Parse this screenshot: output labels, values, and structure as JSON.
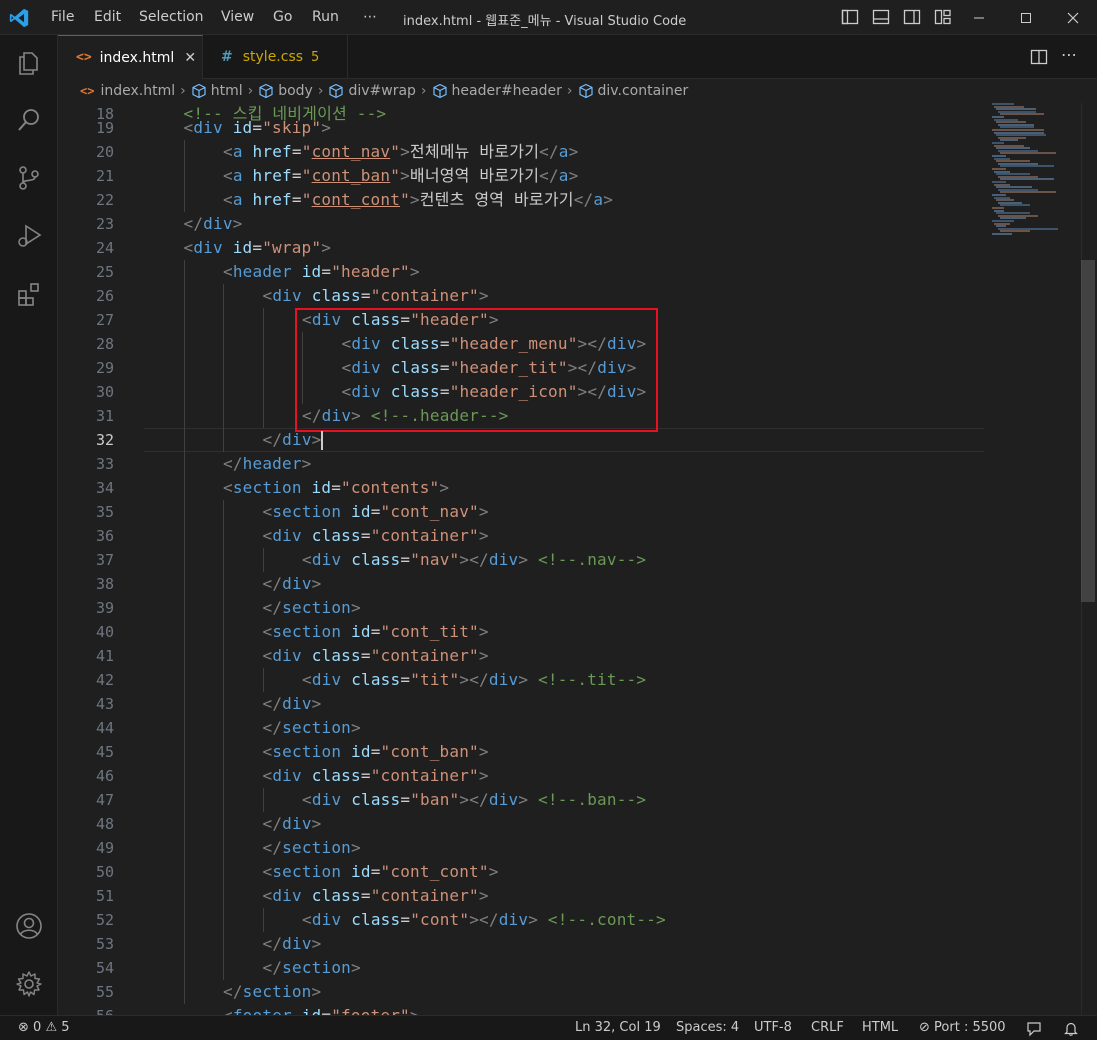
{
  "menu": [
    "File",
    "Edit",
    "Selection",
    "View",
    "Go",
    "Run",
    "⋯"
  ],
  "window_title": "index.html - 웹표준_메뉴 - Visual Studio Code",
  "tabs": [
    {
      "label": "index.html",
      "icon": "html-file-icon",
      "active": true,
      "close": "✕"
    },
    {
      "label": "style.css",
      "icon": "css-file-icon",
      "badge": "5",
      "active": false
    }
  ],
  "breadcrumb": [
    "index.html",
    "html",
    "body",
    "div#wrap",
    "header#header",
    "div.container"
  ],
  "editor": {
    "first_partial_line": {
      "number": "18",
      "text": "<!-- 스킵 네비게이션 -->"
    },
    "current_line": 32,
    "lines": [
      {
        "n": "19",
        "indent": 1,
        "tokens": [
          [
            "br",
            "<"
          ],
          [
            "tag",
            "div"
          ],
          [
            "sp",
            " "
          ],
          [
            "at",
            "id"
          ],
          [
            "eq",
            "="
          ],
          [
            "st",
            "\"skip\""
          ],
          [
            "br",
            ">"
          ]
        ]
      },
      {
        "n": "20",
        "indent": 2,
        "tokens": [
          [
            "br",
            "<"
          ],
          [
            "tag",
            "a"
          ],
          [
            "sp",
            " "
          ],
          [
            "at",
            "href"
          ],
          [
            "eq",
            "="
          ],
          [
            "st",
            "\""
          ],
          [
            "stu",
            "cont_nav"
          ],
          [
            "st",
            "\""
          ],
          [
            "br",
            ">"
          ],
          [
            "tx",
            "전체메뉴 바로가기"
          ],
          [
            "br",
            "</"
          ],
          [
            "tag",
            "a"
          ],
          [
            "br",
            ">"
          ]
        ]
      },
      {
        "n": "21",
        "indent": 2,
        "tokens": [
          [
            "br",
            "<"
          ],
          [
            "tag",
            "a"
          ],
          [
            "sp",
            " "
          ],
          [
            "at",
            "href"
          ],
          [
            "eq",
            "="
          ],
          [
            "st",
            "\""
          ],
          [
            "stu",
            "cont_ban"
          ],
          [
            "st",
            "\""
          ],
          [
            "br",
            ">"
          ],
          [
            "tx",
            "배너영역 바로가기"
          ],
          [
            "br",
            "</"
          ],
          [
            "tag",
            "a"
          ],
          [
            "br",
            ">"
          ]
        ]
      },
      {
        "n": "22",
        "indent": 2,
        "tokens": [
          [
            "br",
            "<"
          ],
          [
            "tag",
            "a"
          ],
          [
            "sp",
            " "
          ],
          [
            "at",
            "href"
          ],
          [
            "eq",
            "="
          ],
          [
            "st",
            "\""
          ],
          [
            "stu",
            "cont_cont"
          ],
          [
            "st",
            "\""
          ],
          [
            "br",
            ">"
          ],
          [
            "tx",
            "컨텐츠 영역 바로가기"
          ],
          [
            "br",
            "</"
          ],
          [
            "tag",
            "a"
          ],
          [
            "br",
            ">"
          ]
        ]
      },
      {
        "n": "23",
        "indent": 1,
        "tokens": [
          [
            "br",
            "</"
          ],
          [
            "tag",
            "div"
          ],
          [
            "br",
            ">"
          ]
        ]
      },
      {
        "n": "24",
        "indent": 1,
        "tokens": [
          [
            "br",
            "<"
          ],
          [
            "tag",
            "div"
          ],
          [
            "sp",
            " "
          ],
          [
            "at",
            "id"
          ],
          [
            "eq",
            "="
          ],
          [
            "st",
            "\"wrap\""
          ],
          [
            "br",
            ">"
          ]
        ]
      },
      {
        "n": "25",
        "indent": 2,
        "tokens": [
          [
            "br",
            "<"
          ],
          [
            "tag",
            "header"
          ],
          [
            "sp",
            " "
          ],
          [
            "at",
            "id"
          ],
          [
            "eq",
            "="
          ],
          [
            "st",
            "\"header\""
          ],
          [
            "br",
            ">"
          ]
        ]
      },
      {
        "n": "26",
        "indent": 3,
        "tokens": [
          [
            "br",
            "<"
          ],
          [
            "tag",
            "div"
          ],
          [
            "sp",
            " "
          ],
          [
            "at",
            "class"
          ],
          [
            "eq",
            "="
          ],
          [
            "st",
            "\"container\""
          ],
          [
            "br",
            ">"
          ]
        ]
      },
      {
        "n": "27",
        "indent": 4,
        "tokens": [
          [
            "br",
            "<"
          ],
          [
            "tag",
            "div"
          ],
          [
            "sp",
            " "
          ],
          [
            "at",
            "class"
          ],
          [
            "eq",
            "="
          ],
          [
            "st",
            "\"header\""
          ],
          [
            "br",
            ">"
          ]
        ]
      },
      {
        "n": "28",
        "indent": 5,
        "tokens": [
          [
            "br",
            "<"
          ],
          [
            "tag",
            "div"
          ],
          [
            "sp",
            " "
          ],
          [
            "at",
            "class"
          ],
          [
            "eq",
            "="
          ],
          [
            "st",
            "\"header_menu\""
          ],
          [
            "br",
            "></"
          ],
          [
            "tag",
            "div"
          ],
          [
            "br",
            ">"
          ]
        ]
      },
      {
        "n": "29",
        "indent": 5,
        "tokens": [
          [
            "br",
            "<"
          ],
          [
            "tag",
            "div"
          ],
          [
            "sp",
            " "
          ],
          [
            "at",
            "class"
          ],
          [
            "eq",
            "="
          ],
          [
            "st",
            "\"header_tit\""
          ],
          [
            "br",
            "></"
          ],
          [
            "tag",
            "div"
          ],
          [
            "br",
            ">"
          ]
        ]
      },
      {
        "n": "30",
        "indent": 5,
        "tokens": [
          [
            "br",
            "<"
          ],
          [
            "tag",
            "div"
          ],
          [
            "sp",
            " "
          ],
          [
            "at",
            "class"
          ],
          [
            "eq",
            "="
          ],
          [
            "st",
            "\"header_icon\""
          ],
          [
            "br",
            "></"
          ],
          [
            "tag",
            "div"
          ],
          [
            "br",
            ">"
          ]
        ]
      },
      {
        "n": "31",
        "indent": 4,
        "tokens": [
          [
            "br",
            "</"
          ],
          [
            "tag",
            "div"
          ],
          [
            "br",
            ">"
          ],
          [
            "sp",
            " "
          ],
          [
            "cm",
            "<!--.header-->"
          ]
        ]
      },
      {
        "n": "32",
        "indent": 3,
        "tokens": [
          [
            "br",
            "</"
          ],
          [
            "tag",
            "div"
          ],
          [
            "br",
            ">"
          ]
        ]
      },
      {
        "n": "33",
        "indent": 2,
        "tokens": [
          [
            "br",
            "</"
          ],
          [
            "tag",
            "header"
          ],
          [
            "br",
            ">"
          ]
        ]
      },
      {
        "n": "34",
        "indent": 2,
        "tokens": [
          [
            "br",
            "<"
          ],
          [
            "tag",
            "section"
          ],
          [
            "sp",
            " "
          ],
          [
            "at",
            "id"
          ],
          [
            "eq",
            "="
          ],
          [
            "st",
            "\"contents\""
          ],
          [
            "br",
            ">"
          ]
        ]
      },
      {
        "n": "35",
        "indent": 3,
        "tokens": [
          [
            "br",
            "<"
          ],
          [
            "tag",
            "section"
          ],
          [
            "sp",
            " "
          ],
          [
            "at",
            "id"
          ],
          [
            "eq",
            "="
          ],
          [
            "st",
            "\"cont_nav\""
          ],
          [
            "br",
            ">"
          ]
        ]
      },
      {
        "n": "36",
        "indent": 3,
        "tokens": [
          [
            "br",
            "<"
          ],
          [
            "tag",
            "div"
          ],
          [
            "sp",
            " "
          ],
          [
            "at",
            "class"
          ],
          [
            "eq",
            "="
          ],
          [
            "st",
            "\"container\""
          ],
          [
            "br",
            ">"
          ]
        ]
      },
      {
        "n": "37",
        "indent": 4,
        "tokens": [
          [
            "br",
            "<"
          ],
          [
            "tag",
            "div"
          ],
          [
            "sp",
            " "
          ],
          [
            "at",
            "class"
          ],
          [
            "eq",
            "="
          ],
          [
            "st",
            "\"nav\""
          ],
          [
            "br",
            "></"
          ],
          [
            "tag",
            "div"
          ],
          [
            "br",
            ">"
          ],
          [
            "sp",
            " "
          ],
          [
            "cm",
            "<!--.nav-->"
          ]
        ]
      },
      {
        "n": "38",
        "indent": 3,
        "tokens": [
          [
            "br",
            "</"
          ],
          [
            "tag",
            "div"
          ],
          [
            "br",
            ">"
          ]
        ]
      },
      {
        "n": "39",
        "indent": 3,
        "tokens": [
          [
            "br",
            "</"
          ],
          [
            "tag",
            "section"
          ],
          [
            "br",
            ">"
          ]
        ]
      },
      {
        "n": "40",
        "indent": 3,
        "tokens": [
          [
            "br",
            "<"
          ],
          [
            "tag",
            "section"
          ],
          [
            "sp",
            " "
          ],
          [
            "at",
            "id"
          ],
          [
            "eq",
            "="
          ],
          [
            "st",
            "\"cont_tit\""
          ],
          [
            "br",
            ">"
          ]
        ]
      },
      {
        "n": "41",
        "indent": 3,
        "tokens": [
          [
            "br",
            "<"
          ],
          [
            "tag",
            "div"
          ],
          [
            "sp",
            " "
          ],
          [
            "at",
            "class"
          ],
          [
            "eq",
            "="
          ],
          [
            "st",
            "\"container\""
          ],
          [
            "br",
            ">"
          ]
        ]
      },
      {
        "n": "42",
        "indent": 4,
        "tokens": [
          [
            "br",
            "<"
          ],
          [
            "tag",
            "div"
          ],
          [
            "sp",
            " "
          ],
          [
            "at",
            "class"
          ],
          [
            "eq",
            "="
          ],
          [
            "st",
            "\"tit\""
          ],
          [
            "br",
            "></"
          ],
          [
            "tag",
            "div"
          ],
          [
            "br",
            ">"
          ],
          [
            "sp",
            " "
          ],
          [
            "cm",
            "<!--.tit-->"
          ]
        ]
      },
      {
        "n": "43",
        "indent": 3,
        "tokens": [
          [
            "br",
            "</"
          ],
          [
            "tag",
            "div"
          ],
          [
            "br",
            ">"
          ]
        ]
      },
      {
        "n": "44",
        "indent": 3,
        "tokens": [
          [
            "br",
            "</"
          ],
          [
            "tag",
            "section"
          ],
          [
            "br",
            ">"
          ]
        ]
      },
      {
        "n": "45",
        "indent": 3,
        "tokens": [
          [
            "br",
            "<"
          ],
          [
            "tag",
            "section"
          ],
          [
            "sp",
            " "
          ],
          [
            "at",
            "id"
          ],
          [
            "eq",
            "="
          ],
          [
            "st",
            "\"cont_ban\""
          ],
          [
            "br",
            ">"
          ]
        ]
      },
      {
        "n": "46",
        "indent": 3,
        "tokens": [
          [
            "br",
            "<"
          ],
          [
            "tag",
            "div"
          ],
          [
            "sp",
            " "
          ],
          [
            "at",
            "class"
          ],
          [
            "eq",
            "="
          ],
          [
            "st",
            "\"container\""
          ],
          [
            "br",
            ">"
          ]
        ]
      },
      {
        "n": "47",
        "indent": 4,
        "tokens": [
          [
            "br",
            "<"
          ],
          [
            "tag",
            "div"
          ],
          [
            "sp",
            " "
          ],
          [
            "at",
            "class"
          ],
          [
            "eq",
            "="
          ],
          [
            "st",
            "\"ban\""
          ],
          [
            "br",
            "></"
          ],
          [
            "tag",
            "div"
          ],
          [
            "br",
            ">"
          ],
          [
            "sp",
            " "
          ],
          [
            "cm",
            "<!--.ban-->"
          ]
        ]
      },
      {
        "n": "48",
        "indent": 3,
        "tokens": [
          [
            "br",
            "</"
          ],
          [
            "tag",
            "div"
          ],
          [
            "br",
            ">"
          ]
        ]
      },
      {
        "n": "49",
        "indent": 3,
        "tokens": [
          [
            "br",
            "</"
          ],
          [
            "tag",
            "section"
          ],
          [
            "br",
            ">"
          ]
        ]
      },
      {
        "n": "50",
        "indent": 3,
        "tokens": [
          [
            "br",
            "<"
          ],
          [
            "tag",
            "section"
          ],
          [
            "sp",
            " "
          ],
          [
            "at",
            "id"
          ],
          [
            "eq",
            "="
          ],
          [
            "st",
            "\"cont_cont\""
          ],
          [
            "br",
            ">"
          ]
        ]
      },
      {
        "n": "51",
        "indent": 3,
        "tokens": [
          [
            "br",
            "<"
          ],
          [
            "tag",
            "div"
          ],
          [
            "sp",
            " "
          ],
          [
            "at",
            "class"
          ],
          [
            "eq",
            "="
          ],
          [
            "st",
            "\"container\""
          ],
          [
            "br",
            ">"
          ]
        ]
      },
      {
        "n": "52",
        "indent": 4,
        "tokens": [
          [
            "br",
            "<"
          ],
          [
            "tag",
            "div"
          ],
          [
            "sp",
            " "
          ],
          [
            "at",
            "class"
          ],
          [
            "eq",
            "="
          ],
          [
            "st",
            "\"cont\""
          ],
          [
            "br",
            "></"
          ],
          [
            "tag",
            "div"
          ],
          [
            "br",
            ">"
          ],
          [
            "sp",
            " "
          ],
          [
            "cm",
            "<!--.cont-->"
          ]
        ]
      },
      {
        "n": "53",
        "indent": 3,
        "tokens": [
          [
            "br",
            "</"
          ],
          [
            "tag",
            "div"
          ],
          [
            "br",
            ">"
          ]
        ]
      },
      {
        "n": "54",
        "indent": 3,
        "tokens": [
          [
            "br",
            "</"
          ],
          [
            "tag",
            "section"
          ],
          [
            "br",
            ">"
          ]
        ]
      },
      {
        "n": "55",
        "indent": 2,
        "tokens": [
          [
            "br",
            "</"
          ],
          [
            "tag",
            "section"
          ],
          [
            "br",
            ">"
          ]
        ]
      }
    ],
    "last_partial_line": {
      "number": "56",
      "text": "<footer id=\"footer\">"
    }
  },
  "statusbar": {
    "errors": "0",
    "warnings": "5",
    "position": "Ln 32, Col 19",
    "spaces": "Spaces: 4",
    "encoding": "UTF-8",
    "eol": "CRLF",
    "language": "HTML",
    "port": "Port : 5500"
  },
  "colors": {
    "tag": "#569cd6",
    "attribute": "#9cdcfe",
    "string": "#ce9178",
    "comment": "#6a9955",
    "bracket": "#808080",
    "highlight_box": "#e81123"
  }
}
